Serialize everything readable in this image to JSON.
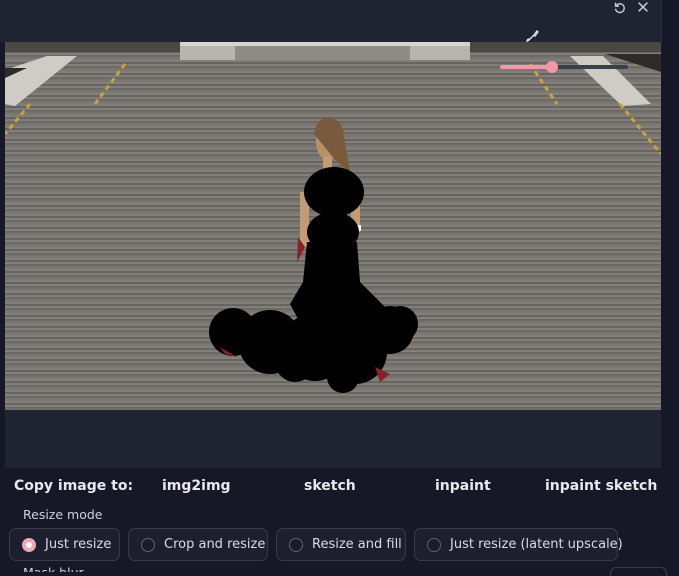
{
  "toolbar": {
    "undo_icon": "undo-icon",
    "close_icon": "close-icon",
    "brush_icon": "brush-icon",
    "brush_size_fraction": 0.41
  },
  "copy": {
    "label": "Copy image to:",
    "targets": [
      "img2img",
      "sketch",
      "inpaint",
      "inpaint sketch"
    ]
  },
  "resize_mode": {
    "title": "Resize mode",
    "options": [
      "Just resize",
      "Crop and resize",
      "Resize and fill",
      "Just resize (latent upscale)"
    ],
    "selected": "Just resize"
  },
  "next_section_partial": "Mask blur",
  "colors": {
    "accent": "#ef9aa6",
    "panel": "#1f2433",
    "background": "#161827"
  }
}
